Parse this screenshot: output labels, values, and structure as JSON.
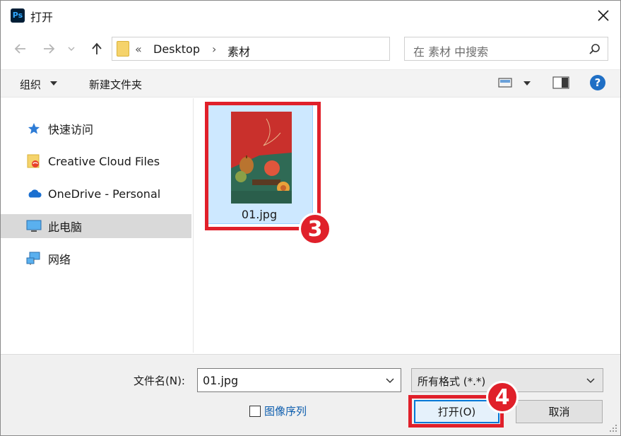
{
  "window": {
    "app_icon_text": "Ps",
    "title": "打开",
    "close_symbol": "✕"
  },
  "address_bar": {
    "overflow": "«",
    "crumbs": [
      "Desktop",
      "素材"
    ],
    "separator": "›"
  },
  "search": {
    "placeholder": "在 素材 中搜索"
  },
  "toolbar": {
    "organize_label": "组织",
    "new_folder_label": "新建文件夹"
  },
  "sidebar": {
    "items": [
      {
        "label": "快速访问",
        "icon": "star-icon"
      },
      {
        "label": "Creative Cloud Files",
        "icon": "creative-cloud-icon"
      },
      {
        "label": "OneDrive - Personal",
        "icon": "onedrive-icon"
      },
      {
        "label": "此电脑",
        "icon": "computer-icon",
        "selected": true
      },
      {
        "label": "网络",
        "icon": "network-icon"
      }
    ]
  },
  "files": [
    {
      "name": "01.jpg",
      "selected": true
    }
  ],
  "annotations": {
    "step3": "3",
    "step4": "4",
    "color": "#e0202a"
  },
  "bottom": {
    "filename_label": "文件名(N):",
    "filename_value": "01.jpg",
    "filetype_value": "所有格式 (*.*)",
    "image_sequence_label": "图像序列",
    "open_label": "打开(O)",
    "cancel_label": "取消"
  }
}
